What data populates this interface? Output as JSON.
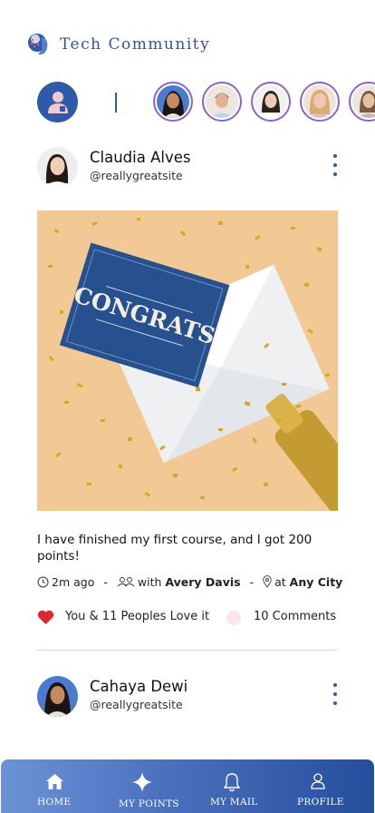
{
  "app": {
    "title": "Tech Community"
  },
  "stories": {
    "self_icon": "user-icon",
    "count": 5
  },
  "posts": [
    {
      "user_name": "Claudia Alves",
      "user_handle": "@reallygreatsite",
      "image_text": "CONGRATS",
      "text": "I have finished my first course, and I got 200 points!",
      "time": "2m ago",
      "with_label": "with",
      "with_name": "Avery Davis",
      "at_label": "at",
      "location": "Any City",
      "likes": "You & 11 Peoples Love it",
      "comments": "10 Comments"
    },
    {
      "user_name": "Cahaya Dewi",
      "user_handle": "@reallygreatsite"
    }
  ],
  "nav": {
    "home": "HOME",
    "points": "MY POINTS",
    "mail": "MY MAIL",
    "profile": "PROFILE"
  },
  "colors": {
    "accent": "#2e5aa8",
    "title": "#2f5597",
    "heart": "#e0262e",
    "story_ring": "#8a63c9"
  }
}
